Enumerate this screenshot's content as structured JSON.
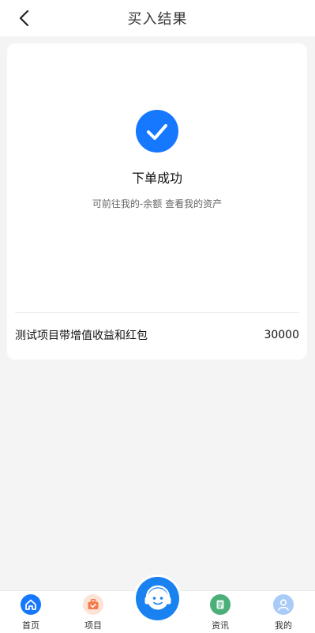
{
  "header": {
    "title": "买入结果"
  },
  "result": {
    "title": "下单成功",
    "tip": "可前往我的-余额 查看我的资产"
  },
  "product": {
    "name": "测试项目带增值收益和红包",
    "amount": "30000"
  },
  "tabbar": {
    "items": [
      {
        "label": "首页",
        "icon": "home-icon",
        "color": "#1677ff"
      },
      {
        "label": "项目",
        "icon": "briefcase-icon",
        "color": "#f47c4c"
      },
      {
        "label": "资讯",
        "icon": "document-icon",
        "color": "#4caf7a"
      },
      {
        "label": "我的",
        "icon": "user-icon",
        "color": "#7fb2f3"
      }
    ],
    "center": {
      "icon": "customer-service-icon",
      "color": "#1a82f0"
    }
  },
  "colors": {
    "primary": "#1677ff",
    "background": "#f4f4f4"
  }
}
